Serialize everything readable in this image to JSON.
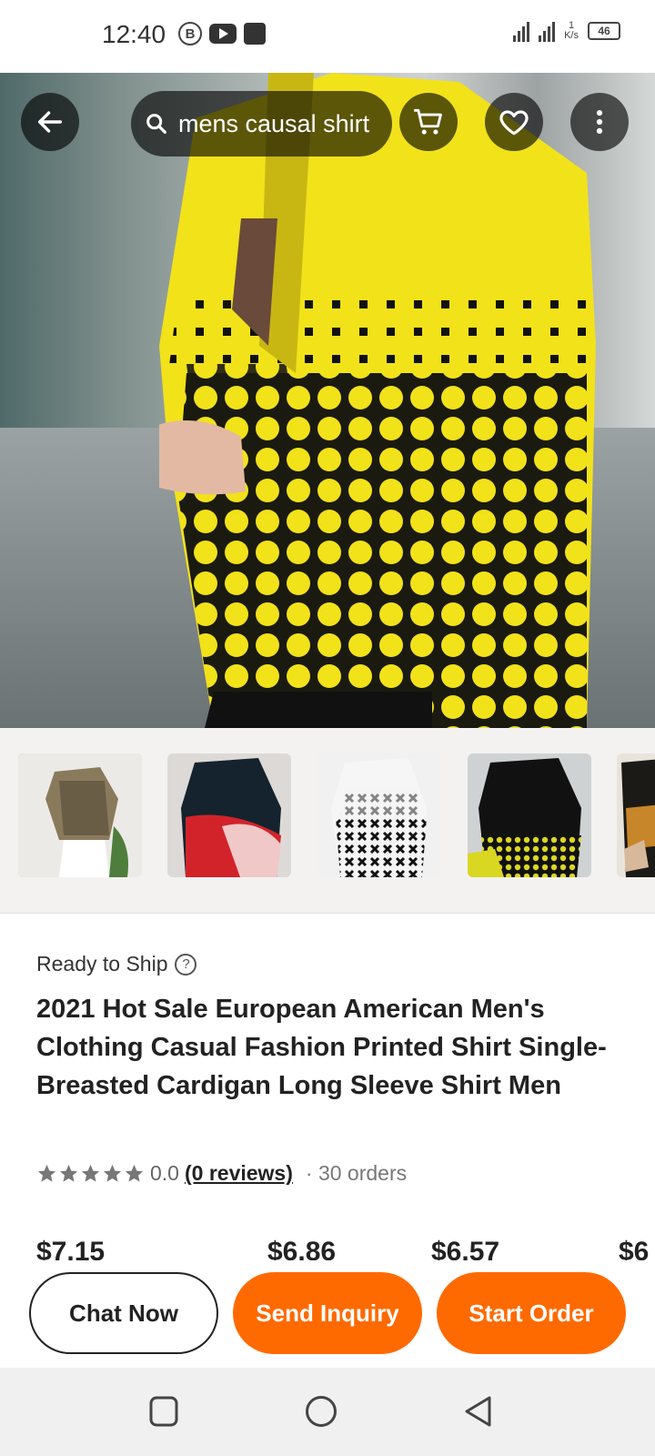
{
  "status_bar": {
    "time": "12:40",
    "badge_letter": "B",
    "network_type": "4G",
    "speed_value": "1",
    "speed_unit": "K/s",
    "battery": "46"
  },
  "top_nav": {
    "search_text": "mens causal shirt",
    "icons": [
      "back-arrow-icon",
      "search-icon",
      "cart-icon",
      "heart-icon",
      "more-vertical-icon"
    ]
  },
  "thumbnails": [
    {
      "name": "thumbnail-1",
      "style": "paisley"
    },
    {
      "name": "thumbnail-2",
      "style": "red-black"
    },
    {
      "name": "thumbnail-3",
      "style": "white-cross"
    },
    {
      "name": "thumbnail-4",
      "style": "black-yellow"
    },
    {
      "name": "thumbnail-5",
      "style": "partial"
    }
  ],
  "product": {
    "ready_to_ship": "Ready to Ship",
    "help_symbol": "?",
    "title": "2021 Hot Sale European American Men's Clothing Casual Fashion Printed Shirt Single-Breasted Cardigan Long Sleeve Shirt Men",
    "rating_value": "0.0",
    "reviews": "(0 reviews)",
    "orders": "· 30 orders",
    "stars_filled": 0,
    "stars_total": 5
  },
  "prices_partial": [
    "$7.15",
    "$6.86",
    "$6.57",
    "$6"
  ],
  "actions": {
    "chat_label": "Chat Now",
    "inquiry_label": "Send Inquiry",
    "order_label": "Start Order"
  },
  "colors": {
    "accent_orange": "#ff6a00",
    "shirt_yellow": "#f2e21a"
  },
  "system_nav": [
    "recents-square-icon",
    "home-circle-icon",
    "back-triangle-icon"
  ]
}
